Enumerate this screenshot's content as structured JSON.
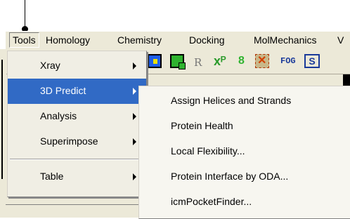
{
  "menubar": {
    "items": [
      {
        "label": "Tools"
      },
      {
        "label": "Homology"
      },
      {
        "label": "Chemistry"
      },
      {
        "label": "Docking"
      },
      {
        "label": "MolMechanics"
      },
      {
        "label": "V"
      }
    ]
  },
  "toolbar": {
    "icons": [
      {
        "name": "structure-view-icon"
      },
      {
        "name": "copy-selection-icon"
      },
      {
        "name": "residue-label-icon",
        "text": "R"
      },
      {
        "name": "connect-atoms-icon",
        "text": "xᴾ"
      },
      {
        "name": "bond-icon",
        "text": "8"
      },
      {
        "name": "delete-molecule-icon"
      },
      {
        "name": "fog-icon",
        "text": "FOG"
      },
      {
        "name": "surface-icon",
        "text": "S"
      }
    ]
  },
  "tools_menu": {
    "items": [
      {
        "label": "Xray",
        "has_submenu": true
      },
      {
        "label": "3D Predict",
        "has_submenu": true,
        "highlighted": true
      },
      {
        "label": "Analysis",
        "has_submenu": true
      },
      {
        "label": "Superimpose",
        "has_submenu": true
      },
      {
        "label": "Table",
        "has_submenu": true
      }
    ]
  },
  "submenu_3d_predict": {
    "items": [
      {
        "label": "Assign Helices and Strands"
      },
      {
        "label": "Protein Health"
      },
      {
        "label": "Local Flexibility..."
      },
      {
        "label": "Protein Interface by ODA..."
      },
      {
        "label": "icmPocketFinder..."
      }
    ]
  },
  "colors": {
    "menu_highlight": "#316ac5",
    "chrome": "#ece9d8"
  }
}
